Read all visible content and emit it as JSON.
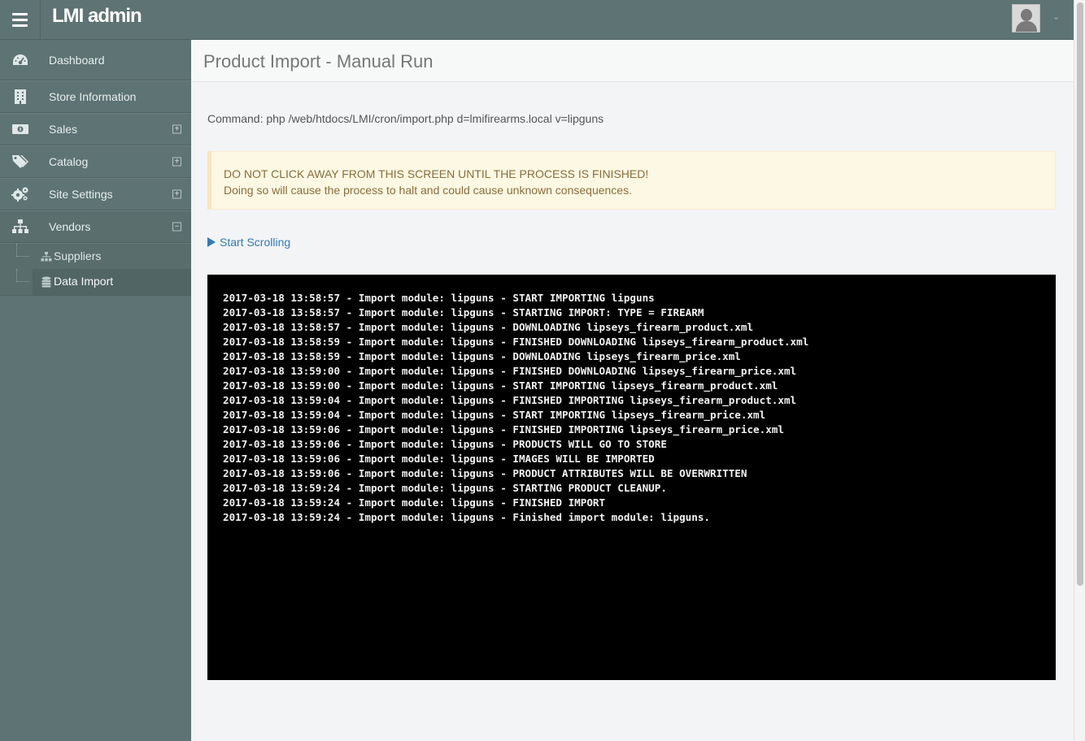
{
  "header": {
    "brand": "LMI admin",
    "menu_icon": "hamburger-menu-icon",
    "user_icon": "user-avatar-icon",
    "user_caret": "chevron-down-icon"
  },
  "sidebar": {
    "items": [
      {
        "label": "Dashboard",
        "icon": "dashboard-icon",
        "expander": ""
      },
      {
        "label": "Store Information",
        "icon": "building-icon",
        "expander": ""
      },
      {
        "label": "Sales",
        "icon": "money-icon",
        "expander": "+"
      },
      {
        "label": "Catalog",
        "icon": "tags-icon",
        "expander": "+"
      },
      {
        "label": "Site Settings",
        "icon": "gears-icon",
        "expander": "+"
      },
      {
        "label": "Vendors",
        "icon": "sitemap-icon",
        "expander": "−"
      }
    ],
    "subitems": [
      {
        "label": "Suppliers",
        "icon": "sitemap-icon"
      },
      {
        "label": "Data Import",
        "icon": "database-icon"
      }
    ]
  },
  "main": {
    "title": "Product Import - Manual Run",
    "command": "Command: php /web/htdocs/LMI/cron/import.php d=lmifirearms.local v=lipguns",
    "alert": {
      "line1": "DO NOT CLICK AWAY FROM THIS SCREEN UNTIL THE PROCESS IS FINISHED!",
      "line2": "Doing so will cause the process to halt and could cause unknown consequences."
    },
    "start_scrolling": "Start Scrolling",
    "log": [
      "2017-03-18 13:58:57 - Import module: lipguns - START IMPORTING lipguns",
      "2017-03-18 13:58:57 - Import module: lipguns - STARTING IMPORT: TYPE = FIREARM",
      "2017-03-18 13:58:57 - Import module: lipguns - DOWNLOADING lipseys_firearm_product.xml",
      "2017-03-18 13:58:59 - Import module: lipguns - FINISHED DOWNLOADING lipseys_firearm_product.xml",
      "2017-03-18 13:58:59 - Import module: lipguns - DOWNLOADING lipseys_firearm_price.xml",
      "2017-03-18 13:59:00 - Import module: lipguns - FINISHED DOWNLOADING lipseys_firearm_price.xml",
      "2017-03-18 13:59:00 - Import module: lipguns - START IMPORTING lipseys_firearm_product.xml",
      "2017-03-18 13:59:04 - Import module: lipguns - FINISHED IMPORTING lipseys_firearm_product.xml",
      "2017-03-18 13:59:04 - Import module: lipguns - START IMPORTING lipseys_firearm_price.xml",
      "2017-03-18 13:59:06 - Import module: lipguns - FINISHED IMPORTING lipseys_firearm_price.xml",
      "2017-03-18 13:59:06 - Import module: lipguns - PRODUCTS WILL GO TO STORE",
      "2017-03-18 13:59:06 - Import module: lipguns - IMAGES WILL BE IMPORTED",
      "2017-03-18 13:59:06 - Import module: lipguns - PRODUCT ATTRIBUTES WILL BE OVERWRITTEN",
      "2017-03-18 13:59:24 - Import module: lipguns - STARTING PRODUCT CLEANUP.",
      "2017-03-18 13:59:24 - Import module: lipguns - FINISHED IMPORT",
      "2017-03-18 13:59:24 - Import module: lipguns - Finished import module: lipguns."
    ]
  },
  "colors": {
    "sidebar_bg": "#5e7373",
    "console_bg": "#000000",
    "alert_bg": "#fcf8e3",
    "alert_text": "#8a6d3b",
    "link": "#337ab7"
  }
}
